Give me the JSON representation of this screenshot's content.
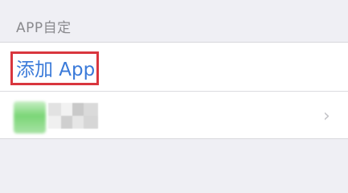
{
  "section": {
    "header": "APP自定"
  },
  "rows": {
    "add_app_label": "添加 App"
  },
  "icons": {
    "chevron": "chevron-right-icon",
    "chevron_glyph": "›"
  },
  "colors": {
    "accent": "#3a7ad9",
    "highlight_border": "#d9363e",
    "background": "#efeff4"
  }
}
